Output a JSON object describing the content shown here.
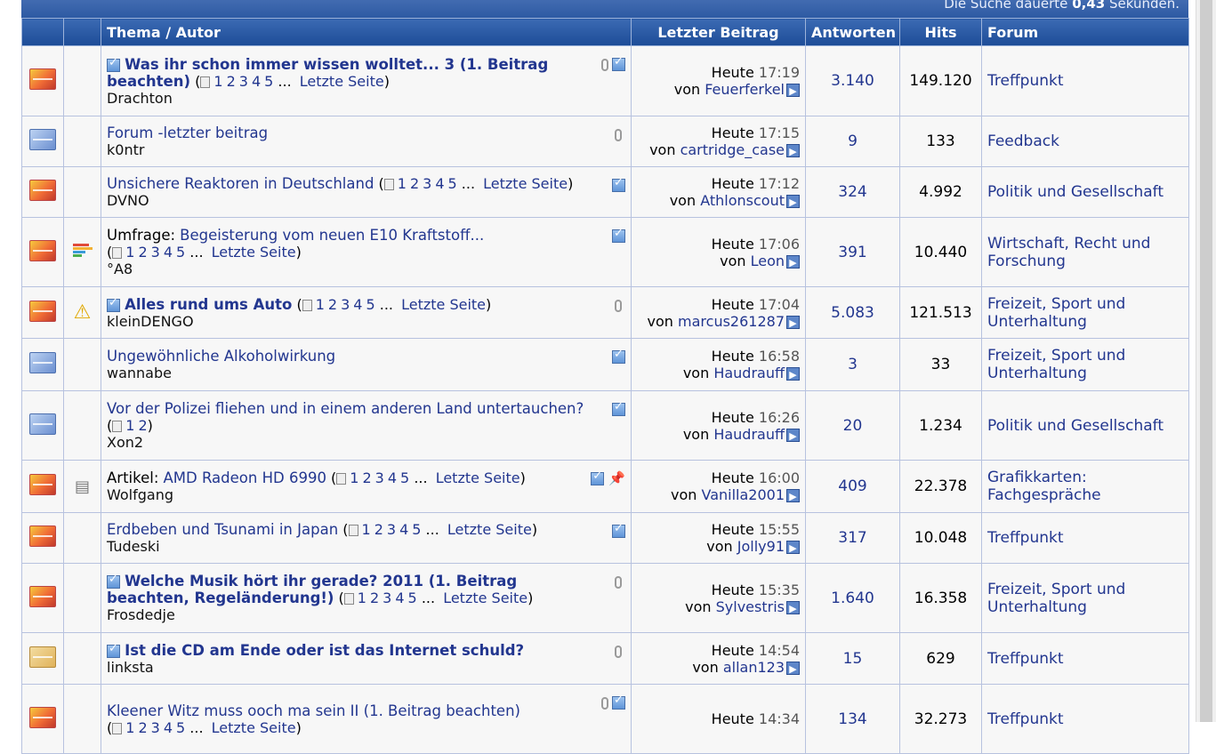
{
  "search_info": {
    "prefix": "Die Suche dauerte",
    "value": "0,43",
    "suffix": "Sekunden."
  },
  "columns": {
    "thema": "Thema / Autor",
    "letzter": "Letzter Beitrag",
    "antworten": "Antworten",
    "hits": "Hits",
    "forum": "Forum"
  },
  "pages_all": [
    "1",
    "2",
    "3",
    "4",
    "5"
  ],
  "pages_two": [
    "1",
    "2"
  ],
  "ellipsis": "...",
  "last_page": "Letzte Seite",
  "von": "von",
  "rows": [
    {
      "prefix": "",
      "title": "Was ihr schon immer wissen wolltet... 3 (1. Beitrag beachten)",
      "bold": true,
      "author": "Drachton",
      "day": "Heute",
      "time": "17:19",
      "by": "Feuerferkel",
      "replies": "3.140",
      "hits": "149.120",
      "forum": "Treffpunkt"
    },
    {
      "prefix": "",
      "title": "Forum -letzter beitrag",
      "bold": false,
      "author": "k0ntr",
      "day": "Heute",
      "time": "17:15",
      "by": "cartridge_case",
      "replies": "9",
      "hits": "133",
      "forum": "Feedback"
    },
    {
      "prefix": "",
      "title": "Unsichere Reaktoren in Deutschland",
      "bold": false,
      "author": "DVNO",
      "day": "Heute",
      "time": "17:12",
      "by": "Athlonscout",
      "replies": "324",
      "hits": "4.992",
      "forum": "Politik und Gesellschaft"
    },
    {
      "prefix": "Umfrage:",
      "title": "Begeisterung vom neuen E10 Kraftstoff...",
      "bold": false,
      "author": "°A8",
      "day": "Heute",
      "time": "17:06",
      "by": "Leon",
      "replies": "391",
      "hits": "10.440",
      "forum": "Wirtschaft, Recht und Forschung"
    },
    {
      "prefix": "",
      "title": "Alles rund ums Auto",
      "bold": true,
      "author": "kleinDENGO",
      "day": "Heute",
      "time": "17:04",
      "by": "marcus261287",
      "replies": "5.083",
      "hits": "121.513",
      "forum": "Freizeit, Sport und Unterhaltung"
    },
    {
      "prefix": "",
      "title": "Ungewöhnliche Alkoholwirkung",
      "bold": false,
      "author": "wannabe",
      "day": "Heute",
      "time": "16:58",
      "by": "Haudrauff",
      "replies": "3",
      "hits": "33",
      "forum": "Freizeit, Sport und Unterhaltung"
    },
    {
      "prefix": "",
      "title": "Vor der Polizei fliehen und in einem anderen Land untertauchen?",
      "bold": false,
      "author": "Xon2",
      "day": "Heute",
      "time": "16:26",
      "by": "Haudrauff",
      "replies": "20",
      "hits": "1.234",
      "forum": "Politik und Gesellschaft"
    },
    {
      "prefix": "Artikel:",
      "title": "AMD Radeon HD 6990",
      "bold": false,
      "author": "Wolfgang",
      "day": "Heute",
      "time": "16:00",
      "by": "Vanilla2001",
      "replies": "409",
      "hits": "22.378",
      "forum": "Grafikkarten: Fachgespräche"
    },
    {
      "prefix": "",
      "title": "Erdbeben und Tsunami in Japan",
      "bold": false,
      "author": "Tudeski",
      "day": "Heute",
      "time": "15:55",
      "by": "Jolly91",
      "replies": "317",
      "hits": "10.048",
      "forum": "Treffpunkt"
    },
    {
      "prefix": "",
      "title": "Welche Musik hört ihr gerade? 2011 (1. Beitrag beachten, Regeländerung!)",
      "bold": true,
      "author": "Frosdedje",
      "day": "Heute",
      "time": "15:35",
      "by": "Sylvestris",
      "replies": "1.640",
      "hits": "16.358",
      "forum": "Freizeit, Sport und Unterhaltung"
    },
    {
      "prefix": "",
      "title": "Ist die CD am Ende oder ist das Internet schuld?",
      "bold": true,
      "author": "linksta",
      "day": "Heute",
      "time": "14:54",
      "by": "allan123",
      "replies": "15",
      "hits": "629",
      "forum": "Treffpunkt"
    },
    {
      "prefix": "",
      "title": "Kleener Witz muss ooch ma sein II (1. Beitrag beachten)",
      "bold": false,
      "author": "",
      "day": "Heute",
      "time": "14:34",
      "by": "",
      "replies": "134",
      "hits": "32.273",
      "forum": "Treffpunkt"
    }
  ]
}
